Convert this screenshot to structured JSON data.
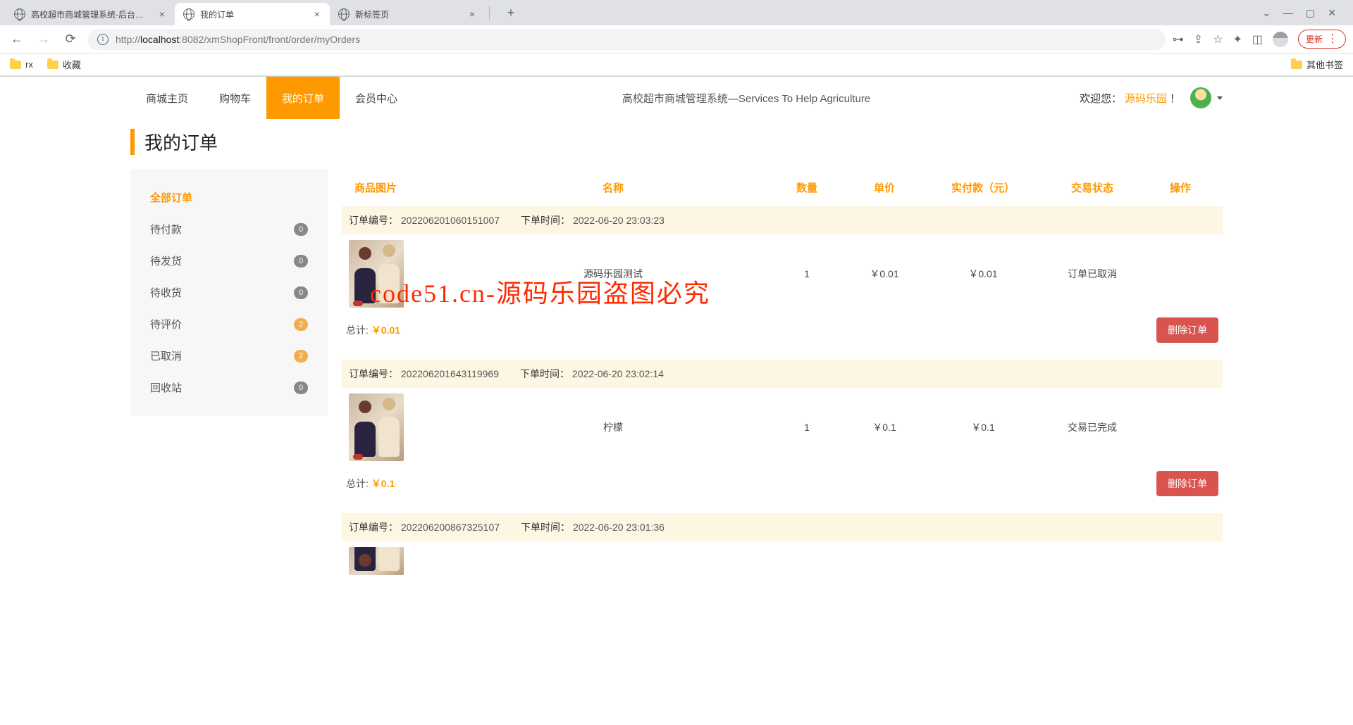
{
  "browser": {
    "tabs": [
      {
        "title": "高校超市商城管理系统-后台管理"
      },
      {
        "title": "我的订单"
      },
      {
        "title": "新标签页"
      }
    ],
    "url_prefix": "http://",
    "url_host": "localhost",
    "url_port_path": ":8082/xmShopFront/front/order/myOrders",
    "update_label": "更新",
    "bookmarks": [
      {
        "label": "rx"
      },
      {
        "label": "收藏"
      }
    ],
    "other_bookmarks": "其他书签"
  },
  "nav": {
    "items": [
      "商城主页",
      "购物车",
      "我的订单",
      "会员中心"
    ],
    "active_index": 2,
    "slogan": "高校超市商城管理系统—Services To Help Agriculture",
    "welcome_prefix": "欢迎您：",
    "username": "源码乐园",
    "welcome_suffix": "！"
  },
  "page_title": "我的订单",
  "sidebar": {
    "items": [
      {
        "label": "全部订单",
        "count": null,
        "active": true
      },
      {
        "label": "待付款",
        "count": "0"
      },
      {
        "label": "待发货",
        "count": "0"
      },
      {
        "label": "待收货",
        "count": "0"
      },
      {
        "label": "待评价",
        "count": "2",
        "warn": true
      },
      {
        "label": "已取消",
        "count": "2",
        "warn": true
      },
      {
        "label": "回收站",
        "count": "0"
      }
    ]
  },
  "table_headers": [
    "商品图片",
    "名称",
    "数量",
    "单价",
    "实付款（元）",
    "交易状态",
    "操作"
  ],
  "orders": [
    {
      "order_no_label": "订单编号：",
      "order_no": "202206201060151007",
      "order_time_label": "下单时间：",
      "order_time": "2022-06-20 23:03:23",
      "item": {
        "name": "源码乐园测试",
        "qty": "1",
        "unit_price": "￥0.01",
        "paid": "￥0.01",
        "status": "订单已取消"
      },
      "total_label": "总计:",
      "total_amount": "￥0.01",
      "delete_label": "删除订单"
    },
    {
      "order_no_label": "订单编号：",
      "order_no": "202206201643119969",
      "order_time_label": "下单时间：",
      "order_time": "2022-06-20 23:02:14",
      "item": {
        "name": "柠檬",
        "qty": "1",
        "unit_price": "￥0.1",
        "paid": "￥0.1",
        "status": "交易已完成"
      },
      "total_label": "总计:",
      "total_amount": "￥0.1",
      "delete_label": "删除订单"
    },
    {
      "order_no_label": "订单编号：",
      "order_no": "202206200867325107",
      "order_time_label": "下单时间：",
      "order_time": "2022-06-20 23:01:36"
    }
  ],
  "watermark": "code51.cn-源码乐园盗图必究"
}
